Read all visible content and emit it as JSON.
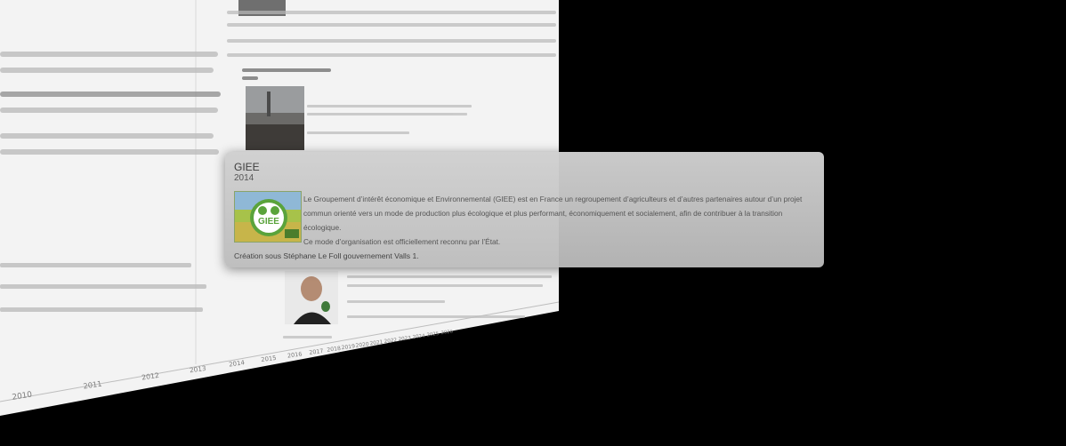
{
  "card": {
    "title": "GIEE",
    "year": "2014",
    "image_logo_text": "GIEE",
    "description_lines": [
      "Le Groupement d’intérêt économique et Environnemental (GIEE) est en France un regroupement d’agriculteurs et d’autres partenaires autour d’un projet",
      "commun orienté vers un mode de production plus écologique et plus performant, économiquement et socialement, afin de contribuer à la transition écologique.",
      "Ce mode d’organisation est officiellement reconnu par l’État."
    ],
    "footer": "Création sous Stéphane Le Foll gouvernement Valls 1."
  },
  "timeline": {
    "axis_years": [
      "2010",
      "2011",
      "2012",
      "2013",
      "2014",
      "2015",
      "2016",
      "2017",
      "2018",
      "2019",
      "2020",
      "2021",
      "2022",
      "2023",
      "2024",
      "2025",
      "2026"
    ]
  }
}
